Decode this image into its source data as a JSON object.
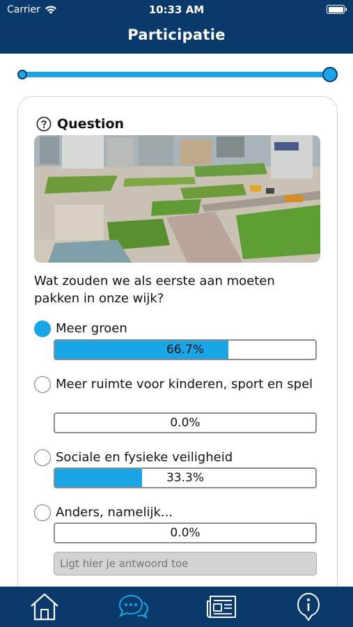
{
  "status_bar": {
    "carrier": "Carrier",
    "time": "10:33 AM"
  },
  "header": {
    "title": "Participatie"
  },
  "progress": {
    "value": 1.0
  },
  "question": {
    "heading": "Question",
    "text": "Wat zouden we als eerste aan moeten pakken in onze wijk?",
    "options": [
      {
        "label": "Meer groen",
        "result": "66.7%",
        "fraction": 0.667,
        "selected": true
      },
      {
        "label": "Meer ruimte voor kinderen, sport en spel",
        "result": "0.0%",
        "fraction": 0.0,
        "selected": false
      },
      {
        "label": "Sociale en fysieke veiligheid",
        "result": "33.3%",
        "fraction": 0.333,
        "selected": false
      },
      {
        "label": "Anders, namelijk...",
        "result": "0.0%",
        "fraction": 0.0,
        "selected": false
      }
    ],
    "answer_placeholder": "Ligt hier je antwoord toe"
  },
  "tabs": [
    "home-icon",
    "chat-icon",
    "news-icon",
    "info-icon"
  ],
  "colors": {
    "navy": "#0a3a6b",
    "accent": "#1aa6e6"
  }
}
